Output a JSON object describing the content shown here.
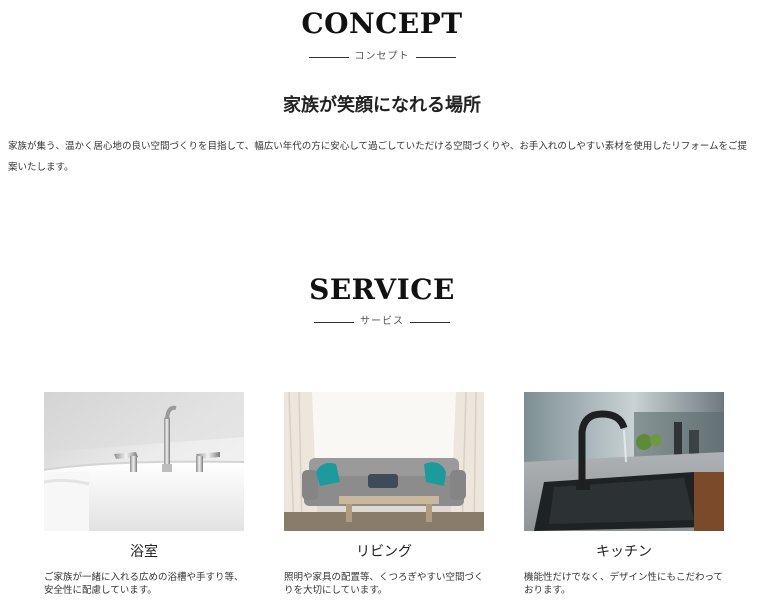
{
  "concept": {
    "title": "CONCEPT",
    "subtitle": "コンセプト",
    "heading": "家族が笑顔になれる場所",
    "body": "家族が集う、温かく居心地の良い空間づくりを目指して、幅広い年代の方に安心して過ごしていただける空間づくりや、お手入れのしやすい素材を使用したリフォームをご提案いたします。"
  },
  "service": {
    "title": "SERVICE",
    "subtitle": "サービス",
    "items": [
      {
        "name": "浴室",
        "desc": "ご家族が一緒に入れる広めの浴槽や手すり等、安全性に配慮しています。"
      },
      {
        "name": "リビング",
        "desc": "照明や家具の配置等、くつろぎやすい空間づくりを大切にしています。"
      },
      {
        "name": "キッチン",
        "desc": "機能性だけでなく、デザイン性にもこだわっております。"
      }
    ]
  }
}
